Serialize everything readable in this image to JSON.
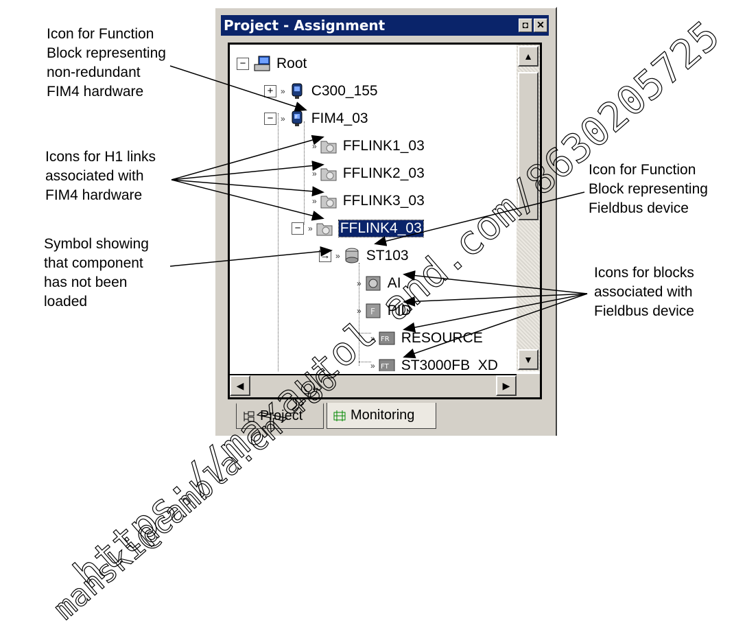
{
  "window": {
    "title": "Project - Assignment",
    "pin_glyph": "◘",
    "close_glyph": "✕"
  },
  "tree": {
    "root": "Root",
    "c300": "C300_155",
    "fim4": "FIM4_03",
    "fflink1": "FFLINK1_03",
    "fflink2": "FFLINK2_03",
    "fflink3": "FFLINK3_03",
    "fflink4": "FFLINK4_03",
    "st103": "ST103",
    "ai": "AI",
    "pid": "PID",
    "resource": "RESOURCE",
    "st3000": "ST3000FB_XD"
  },
  "tabs": {
    "project": "Project",
    "monitoring": "Monitoring"
  },
  "callouts": {
    "fim4_icon": [
      "Icon for Function",
      "Block representing",
      "non-redundant",
      "FIM4 hardware"
    ],
    "h1_links": [
      "Icons for H1 links",
      "associated with",
      "FIM4 hardware"
    ],
    "not_loaded": [
      "Symbol showing",
      "that component",
      "has not been",
      "loaded"
    ],
    "fieldbus_icon": [
      "Icon for Function",
      "Block representing",
      "Fieldbus device"
    ],
    "blocks_icons": [
      "Icons for blocks",
      "associated with",
      "Fieldbus device"
    ]
  },
  "watermark": {
    "line1": "https://maxautol and.com/8630205725",
    "line2": "manski@cambla.cn  +86"
  },
  "colors": {
    "titlebar": "#0a246a",
    "selection": "#0a246a",
    "window": "#d4d0c8"
  }
}
